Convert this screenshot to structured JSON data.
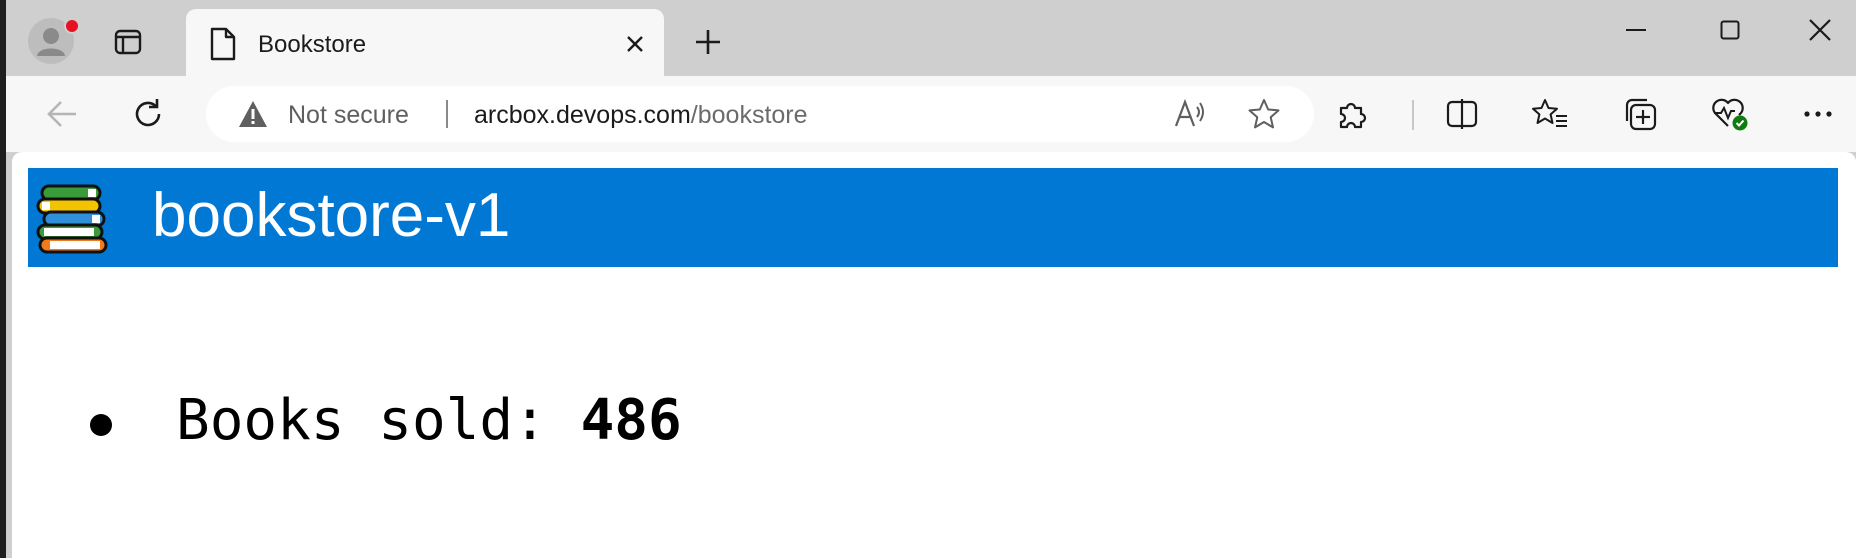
{
  "browser": {
    "tab": {
      "title": "Bookstore",
      "icon": "page-icon"
    },
    "address": {
      "security_label": "Not secure",
      "url_host": "arcbox.devops.com",
      "url_path": "/bookstore"
    },
    "icons": {
      "profile": "profile-icon",
      "tab_actions": "tab-actions-icon",
      "new_tab": "plus-icon",
      "back": "back-arrow-icon",
      "refresh": "refresh-icon",
      "warning": "warning-icon",
      "read_aloud": "read-aloud-icon",
      "favorite": "star-icon",
      "extensions": "puzzle-icon",
      "split_screen": "split-screen-icon",
      "favorites": "favorites-icon",
      "collections": "collections-icon",
      "browser_essentials": "heart-pulse-icon",
      "more": "more-icon"
    },
    "colors": {
      "tab_strip": "#cfcfcf",
      "toolbar": "#f7f7f7",
      "profile_badge": "#e81123",
      "essentials_badge": "#107c10"
    }
  },
  "page": {
    "banner": {
      "title": "bookstore-v1",
      "background": "#0178d4",
      "icon": "books-stack-icon"
    },
    "stats": [
      {
        "label": "Books sold: ",
        "value": "486"
      }
    ]
  }
}
